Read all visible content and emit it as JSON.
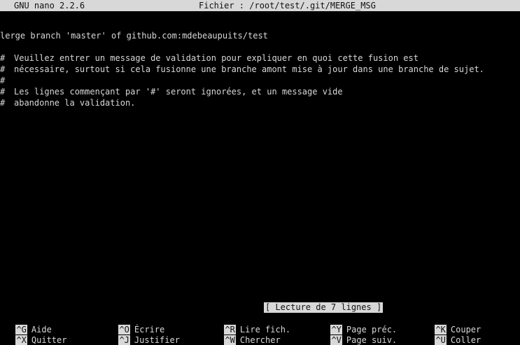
{
  "titlebar": {
    "version": "GNU nano 2.2.6",
    "file": "Fichier : /root/test/.git/MERGE_MSG"
  },
  "buffer": {
    "lines": [
      "lerge branch 'master' of github.com:mdebeaupuits/test",
      "",
      "Veuillez entrer un message de validation pour expliquer en quoi cette fusion est",
      "nécessaire, surtout si cela fusionne une branche amont mise à jour dans une branche de sujet.",
      "",
      "Les lignes commençant par '#' seront ignorées, et un message vide",
      "abandonne la validation."
    ],
    "comment_markers": [
      "#",
      "#",
      "#",
      "#",
      "#"
    ]
  },
  "status": "[ Lecture de 7 lignes ]",
  "shortcuts": [
    {
      "key": "^G",
      "label": "Aide"
    },
    {
      "key": "^O",
      "label": "Écrire"
    },
    {
      "key": "^R",
      "label": "Lire fich."
    },
    {
      "key": "^Y",
      "label": "Page préc."
    },
    {
      "key": "^K",
      "label": "Couper"
    },
    {
      "key": "^X",
      "label": "Quitter"
    },
    {
      "key": "^J",
      "label": "Justifier"
    },
    {
      "key": "^W",
      "label": "Chercher"
    },
    {
      "key": "^V",
      "label": "Page suiv."
    },
    {
      "key": "^U",
      "label": "Coller"
    }
  ]
}
